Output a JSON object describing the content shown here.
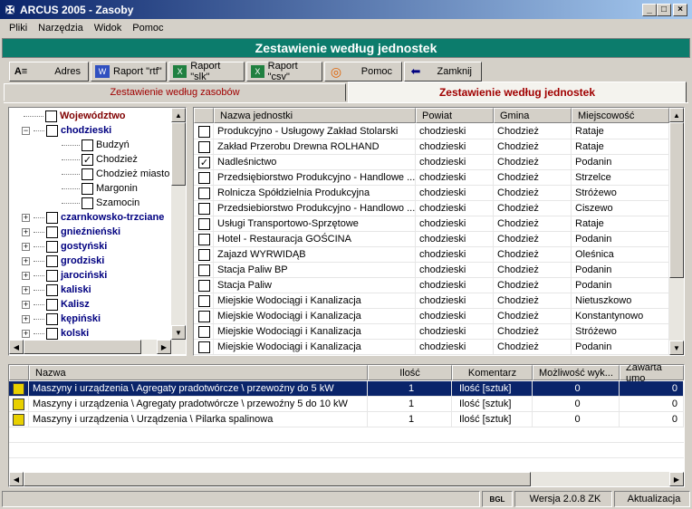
{
  "window": {
    "title": "ARCUS 2005 - Zasoby",
    "min_label": "_",
    "max_label": "□",
    "close_label": "×"
  },
  "menu": [
    "Pliki",
    "Narzędzia",
    "Widok",
    "Pomoc"
  ],
  "banner": "Zestawienie według jednostek",
  "toolbar": {
    "adres": "Adres",
    "rtf": "Raport \"rtf\"",
    "slk": "Raport \"slk\"",
    "csv": "Raport \"csv\"",
    "pomoc": "Pomoc",
    "zamknij": "Zamknij"
  },
  "tabs": {
    "zasoby": "Zestawienie według zasobów",
    "jednostki": "Zestawienie według jednostek"
  },
  "tree": {
    "root": "Województwo",
    "chodzieski": "chodzieski",
    "children": [
      "Budzyń",
      "Chodzież",
      "Chodzież miasto",
      "Margonin",
      "Szamocin"
    ],
    "others": [
      "czarnkowsko-trzciane",
      "gnieźnieński",
      "gostyński",
      "grodziski",
      "jarociński",
      "kaliski",
      "Kalisz",
      "kępiński",
      "kolski"
    ]
  },
  "units": {
    "headers": [
      "Nazwa jednostki",
      "Powiat",
      "Gmina",
      "Miejscowość"
    ],
    "rows": [
      {
        "name": "Produkcyjno - Usługowy Zakład Stolarski",
        "powiat": "chodzieski",
        "gmina": "Chodzież",
        "miejsc": "Rataje",
        "checked": false
      },
      {
        "name": "Zakład Przerobu Drewna ROLHAND",
        "powiat": "chodzieski",
        "gmina": "Chodzież",
        "miejsc": "Rataje",
        "checked": false
      },
      {
        "name": "Nadleśnictwo",
        "powiat": "chodzieski",
        "gmina": "Chodzież",
        "miejsc": "Podanin",
        "checked": true
      },
      {
        "name": "Przedsiębiorstwo Produkcyjno - Handlowe ...",
        "powiat": "chodzieski",
        "gmina": "Chodzież",
        "miejsc": "Strzelce",
        "checked": false
      },
      {
        "name": "Rolnicza Spółdzielnia Produkcyjna",
        "powiat": "chodzieski",
        "gmina": "Chodzież",
        "miejsc": "Stróżewo",
        "checked": false
      },
      {
        "name": "Przedsiebiorstwo Produkcyjno - Handlowo ...",
        "powiat": "chodzieski",
        "gmina": "Chodzież",
        "miejsc": "Ciszewo",
        "checked": false
      },
      {
        "name": "Usługi Transportowo-Sprzętowe",
        "powiat": "chodzieski",
        "gmina": "Chodzież",
        "miejsc": "Rataje",
        "checked": false
      },
      {
        "name": "Hotel - Restauracja GOŚCINA",
        "powiat": "chodzieski",
        "gmina": "Chodzież",
        "miejsc": "Podanin",
        "checked": false
      },
      {
        "name": " Zajazd WYRWIDĄB",
        "powiat": "chodzieski",
        "gmina": "Chodzież",
        "miejsc": "Oleśnica",
        "checked": false
      },
      {
        "name": "Stacja Paliw BP",
        "powiat": "chodzieski",
        "gmina": "Chodzież",
        "miejsc": "Podanin",
        "checked": false
      },
      {
        "name": "Stacja Paliw",
        "powiat": "chodzieski",
        "gmina": "Chodzież",
        "miejsc": "Podanin",
        "checked": false
      },
      {
        "name": "Miejskie Wodociągi i Kanalizacja",
        "powiat": "chodzieski",
        "gmina": "Chodzież",
        "miejsc": "Nietuszkowo",
        "checked": false
      },
      {
        "name": "Miejskie Wodociągi i Kanalizacja",
        "powiat": "chodzieski",
        "gmina": "Chodzież",
        "miejsc": "Konstantynowo",
        "checked": false
      },
      {
        "name": "Miejskie Wodociągi i Kanalizacja",
        "powiat": "chodzieski",
        "gmina": "Chodzież",
        "miejsc": "Stróżewo",
        "checked": false
      },
      {
        "name": "Miejskie Wodociągi i Kanalizacja",
        "powiat": "chodzieski",
        "gmina": "Chodzież",
        "miejsc": "Podanin",
        "checked": false
      }
    ]
  },
  "resources": {
    "headers": [
      "Nazwa",
      "Ilość",
      "Komentarz",
      "Możliwość wyk...",
      "Zawarta umo"
    ],
    "rows": [
      {
        "name": "Maszyny i urządzenia \\ Agregaty pradotwórcze \\ przewoźny do 5 kW",
        "ilosc": "1",
        "kom": "Ilość [sztuk]",
        "mozl": "0",
        "umowa": "0",
        "selected": true
      },
      {
        "name": "Maszyny i urządzenia \\ Agregaty pradotwórcze \\ przewoźny 5 do 10 kW",
        "ilosc": "1",
        "kom": "Ilość [sztuk]",
        "mozl": "0",
        "umowa": "0",
        "selected": false
      },
      {
        "name": "Maszyny i urządzenia \\ Urządzenia \\ Pilarka spalinowa",
        "ilosc": "1",
        "kom": "Ilość [sztuk]",
        "mozl": "0",
        "umowa": "0",
        "selected": false
      }
    ]
  },
  "status": {
    "logo": "BGL",
    "version": "Wersja 2.0.8 ZK",
    "update": "Aktualizacja"
  },
  "colors": {
    "banner": "#0c7c6c",
    "selection": "#0a246a"
  }
}
